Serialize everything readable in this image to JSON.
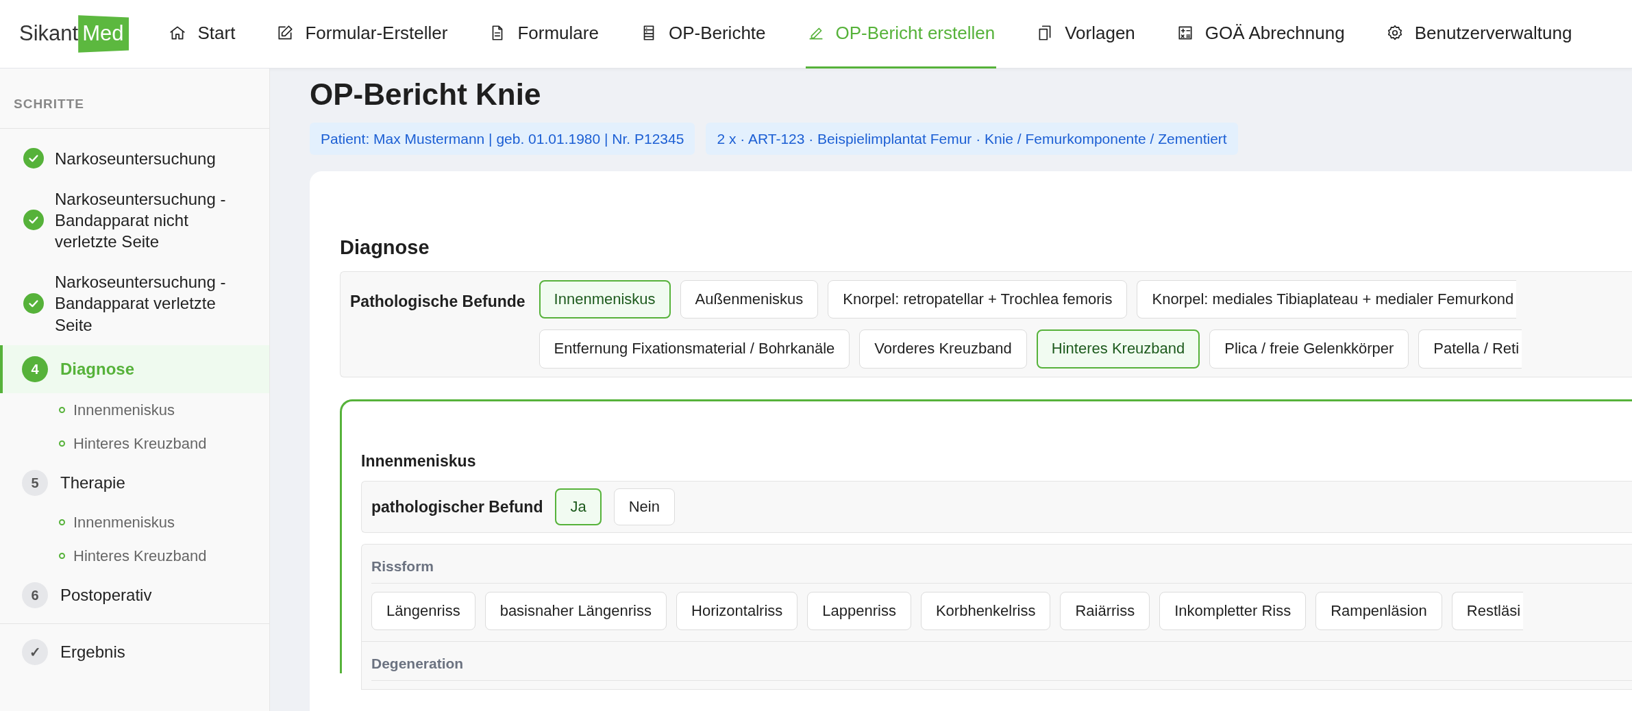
{
  "brand": {
    "first": "Sikant",
    "second": "Med"
  },
  "nav": [
    {
      "label": "Start",
      "selected": false
    },
    {
      "label": "Formular-Ersteller",
      "selected": false
    },
    {
      "label": "Formulare",
      "selected": false
    },
    {
      "label": "OP-Berichte",
      "selected": false
    },
    {
      "label": "OP-Bericht erstellen",
      "selected": true
    },
    {
      "label": "Vorlagen",
      "selected": false
    },
    {
      "label": "GOÄ Abrechnung",
      "selected": false
    },
    {
      "label": "Benutzerverwaltung",
      "selected": false
    }
  ],
  "sidebar": {
    "heading": "SCHRITTE",
    "steps": [
      {
        "done": true,
        "selected": false,
        "label": "Narkoseuntersuchung",
        "divider_before": false
      },
      {
        "done": true,
        "selected": false,
        "label": "Narkoseuntersuchung - Bandapparat nicht verletzte Seite",
        "divider_before": false
      },
      {
        "done": true,
        "selected": false,
        "label": "Narkoseuntersuchung - Bandapparat verletzte Seite",
        "divider_before": false
      },
      {
        "done": false,
        "selected": true,
        "badge": "4",
        "label": "Diagnose",
        "divider_before": false,
        "children": [
          "Innenmeniskus",
          "Hinteres Kreuzband"
        ]
      },
      {
        "done": false,
        "selected": false,
        "badge": "5",
        "label": "Therapie",
        "divider_before": false,
        "children": [
          "Innenmeniskus",
          "Hinteres Kreuzband"
        ]
      },
      {
        "done": false,
        "selected": false,
        "badge": "6",
        "label": "Postoperativ",
        "divider_before": false
      },
      {
        "done": false,
        "selected": false,
        "badge": "✓",
        "label": "Ergebnis",
        "divider_before": true
      }
    ]
  },
  "page": {
    "title": "OP-Bericht Knie",
    "tags": [
      "Patient: Max Mustermann | geb. 01.01.1980 | Nr. P12345",
      "2 x · ART-123 · Beispielimplantat Femur · Knie / Femurkomponente / Zementiert"
    ]
  },
  "diagnosis": {
    "title": "Diagnose",
    "label": "Pathologische Befunde",
    "option_rows": [
      [
        {
          "label": "Innenmeniskus",
          "selected": true
        },
        {
          "label": "Außenmeniskus",
          "selected": false
        },
        {
          "label": "Knorpel: retropatellar + Trochlea femoris",
          "selected": false
        },
        {
          "label": "Knorpel: mediales Tibiaplateau + medialer Femurkond",
          "selected": false
        }
      ],
      [
        {
          "label": "Entfernung Fixationsmaterial / Bohrkanäle",
          "selected": false
        },
        {
          "label": "Vorderes Kreuzband",
          "selected": false
        },
        {
          "label": "Hinteres Kreuzband",
          "selected": true
        },
        {
          "label": "Plica / freie Gelenkkörper",
          "selected": false
        },
        {
          "label": "Patella / Reti",
          "selected": false
        }
      ]
    ]
  },
  "detail": {
    "title": "Innenmeniskus",
    "question": "pathologischer Befund",
    "answers": [
      {
        "label": "Ja",
        "selected": true
      },
      {
        "label": "Nein",
        "selected": false
      }
    ],
    "groups": [
      {
        "title": "Rissform",
        "options": [
          {
            "label": "Längenriss",
            "selected": false
          },
          {
            "label": "basisnaher Längenriss",
            "selected": false
          },
          {
            "label": "Horizontalriss",
            "selected": false
          },
          {
            "label": "Lappenriss",
            "selected": false
          },
          {
            "label": "Korbhenkelriss",
            "selected": false
          },
          {
            "label": "Raiärriss",
            "selected": false
          },
          {
            "label": "Inkompletter Riss",
            "selected": false
          },
          {
            "label": "Rampenläsion",
            "selected": false
          },
          {
            "label": "Restläsi",
            "selected": false
          }
        ]
      },
      {
        "title": "Degeneration"
      }
    ]
  }
}
